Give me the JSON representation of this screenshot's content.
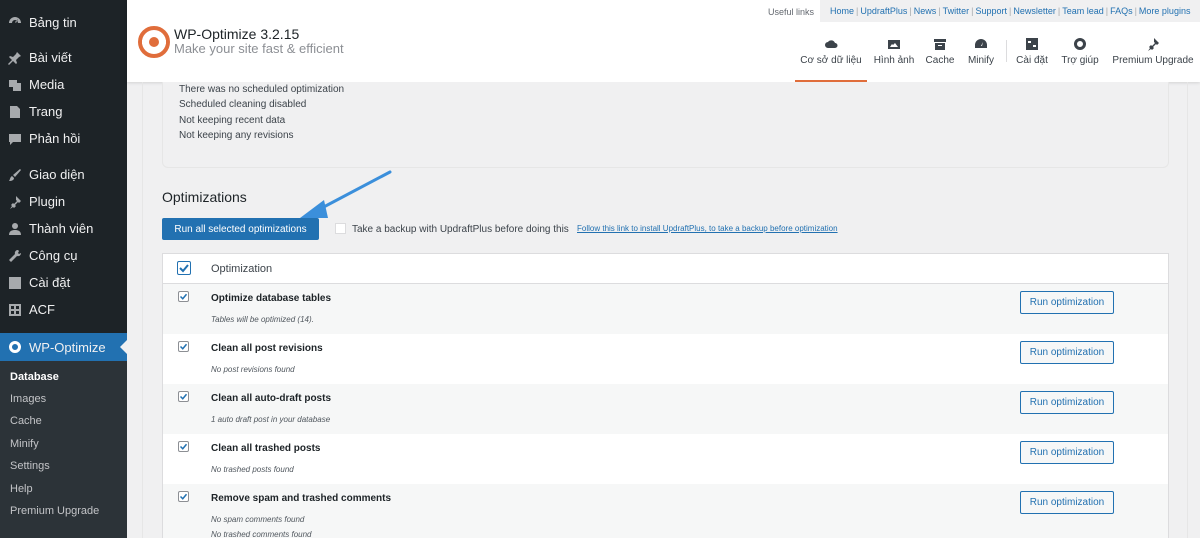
{
  "sidebar": {
    "items": [
      {
        "label": "Bảng tin",
        "icon": "dashboard-icon"
      },
      {
        "label": "Bài viết",
        "icon": "pin-icon"
      },
      {
        "label": "Media",
        "icon": "media-icon"
      },
      {
        "label": "Trang",
        "icon": "page-icon"
      },
      {
        "label": "Phản hồi",
        "icon": "comment-icon"
      },
      {
        "label": "Giao diện",
        "icon": "brush-icon"
      },
      {
        "label": "Plugin",
        "icon": "plugin-icon"
      },
      {
        "label": "Thành viên",
        "icon": "user-icon"
      },
      {
        "label": "Công cụ",
        "icon": "wrench-icon"
      },
      {
        "label": "Cài đặt",
        "icon": "settings-icon"
      },
      {
        "label": "ACF",
        "icon": "acf-icon"
      },
      {
        "label": "WP-Optimize",
        "icon": "wpo-icon"
      }
    ],
    "submenu": [
      "Database",
      "Images",
      "Cache",
      "Minify",
      "Settings",
      "Help",
      "Premium Upgrade"
    ]
  },
  "header": {
    "title": "WP-Optimize 3.2.15",
    "subtitle": "Make your site fast & efficient",
    "useful_links_label": "Useful links",
    "links": [
      "Home",
      "UpdraftPlus",
      "News",
      "Twitter",
      "Support",
      "Newsletter",
      "Team lead",
      "FAQs",
      "More plugins"
    ],
    "tabs": [
      "Cơ sở dữ liệu",
      "Hình ảnh",
      "Cache",
      "Minify",
      "Cài đặt",
      "Trợ giúp",
      "Premium Upgrade"
    ]
  },
  "status": {
    "lines": [
      "There was no scheduled optimization",
      "Scheduled cleaning disabled",
      "Not keeping recent data",
      "Not keeping any revisions"
    ]
  },
  "optimizations": {
    "title": "Optimizations",
    "run_all_label": "Run all selected optimizations",
    "backup_label": "Take a backup with UpdraftPlus before doing this",
    "backup_link": "Follow this link to install UpdraftPlus, to take a backup before optimization",
    "table_header": "Optimization",
    "run_label": "Run optimization",
    "rows": [
      {
        "title": "Optimize database tables",
        "notes": [
          "Tables will be optimized (14)."
        ]
      },
      {
        "title": "Clean all post revisions",
        "notes": [
          "No post revisions found"
        ]
      },
      {
        "title": "Clean all auto-draft posts",
        "notes": [
          "1 auto draft post in your database"
        ]
      },
      {
        "title": "Clean all trashed posts",
        "notes": [
          "No trashed posts found"
        ]
      },
      {
        "title": "Remove spam and trashed comments",
        "notes": [
          "No spam comments found",
          "No trashed comments found"
        ]
      }
    ]
  },
  "colors": {
    "accent": "#2271b1",
    "brand": "#e06d3b",
    "sidebar": "#1d2327"
  }
}
